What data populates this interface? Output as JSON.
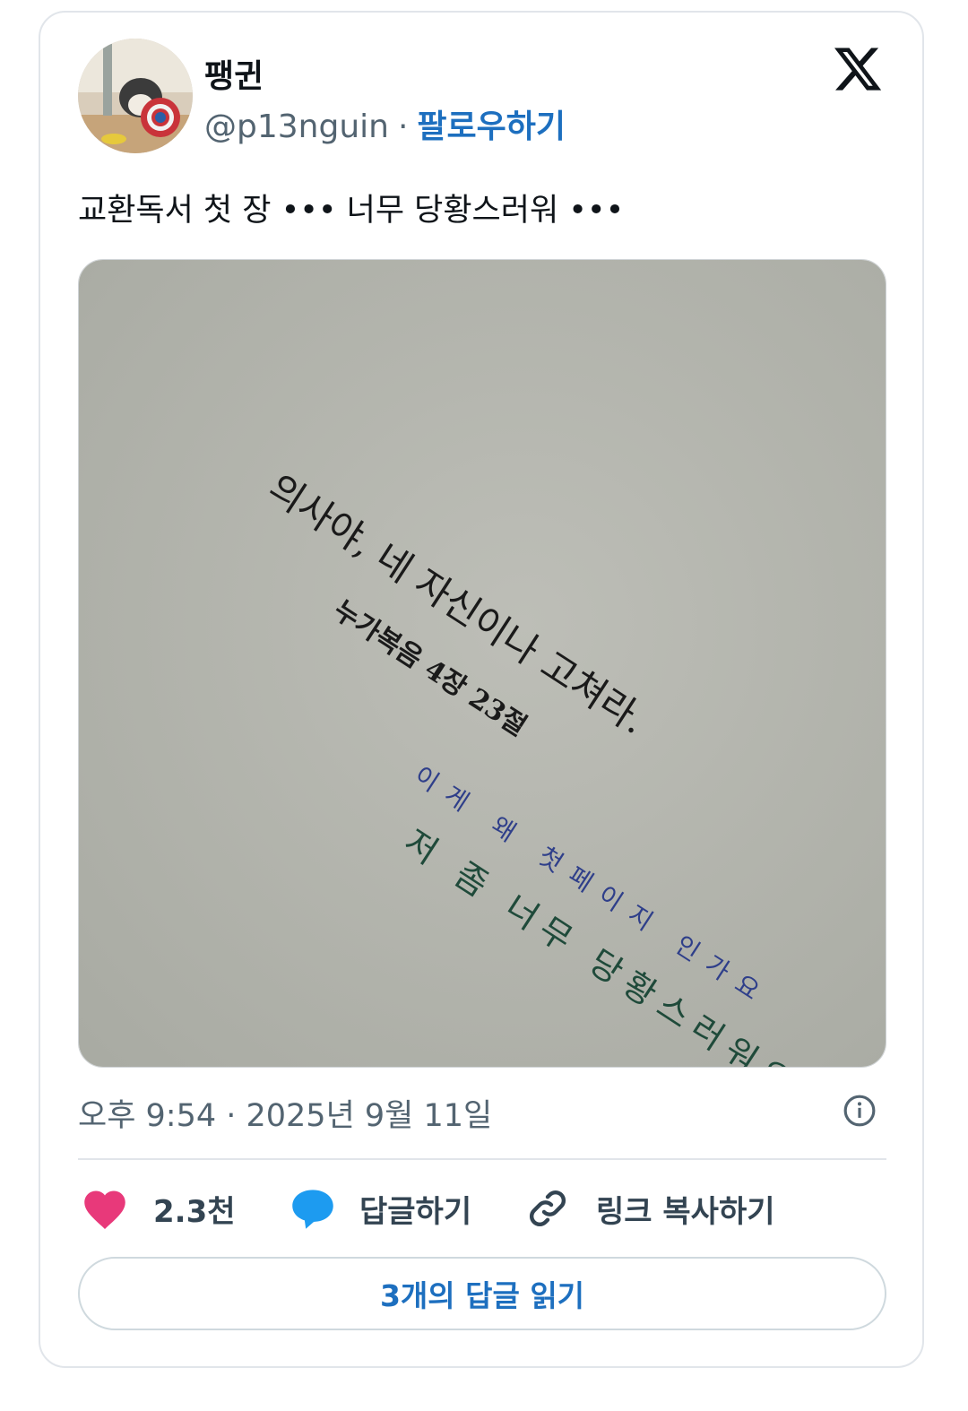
{
  "author": {
    "name": "팽귄",
    "handle": "@p13nguin",
    "separator": "·",
    "follow_label": "팔로우하기"
  },
  "tweet": {
    "text": "교환독서 첫 장 ••• 너무 당황스러워 •••"
  },
  "photo": {
    "printed_line_1": "의사야, 네 자신이나 고쳐라.",
    "printed_line_2": "누가복음 4장 23절",
    "handwritten_line_1": "이게 왜 첫페이지 인가요",
    "handwritten_line_2": "저 좀 너무 당황스러워요."
  },
  "meta": {
    "timestamp": "오후 9:54 · 2025년 9월 11일"
  },
  "actions": {
    "like_count": "2.3천",
    "reply_label": "답글하기",
    "copy_link_label": "링크 복사하기"
  },
  "read_replies_label": "3개의 답글 읽기",
  "colors": {
    "like": "#e8397a",
    "reply": "#1d9bf0",
    "follow": "#1d6fbf",
    "paper": "#b7b8b1"
  }
}
